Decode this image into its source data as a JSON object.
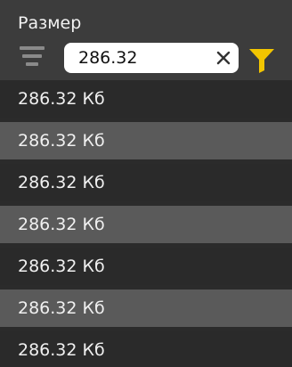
{
  "column": {
    "title": "Размер"
  },
  "filter": {
    "value": "286.32",
    "accent_color": "#f2c500",
    "icons": {
      "menu": "sort-lines-icon",
      "clear": "close-icon",
      "filter": "filter-funnel-icon"
    }
  },
  "rows": [
    {
      "label": "286.32 Кб"
    },
    {
      "label": "286.32 Кб"
    },
    {
      "label": "286.32 Кб"
    },
    {
      "label": "286.32 Кб"
    },
    {
      "label": "286.32 Кб"
    },
    {
      "label": "286.32 Кб"
    },
    {
      "label": "286.32 Кб"
    }
  ]
}
